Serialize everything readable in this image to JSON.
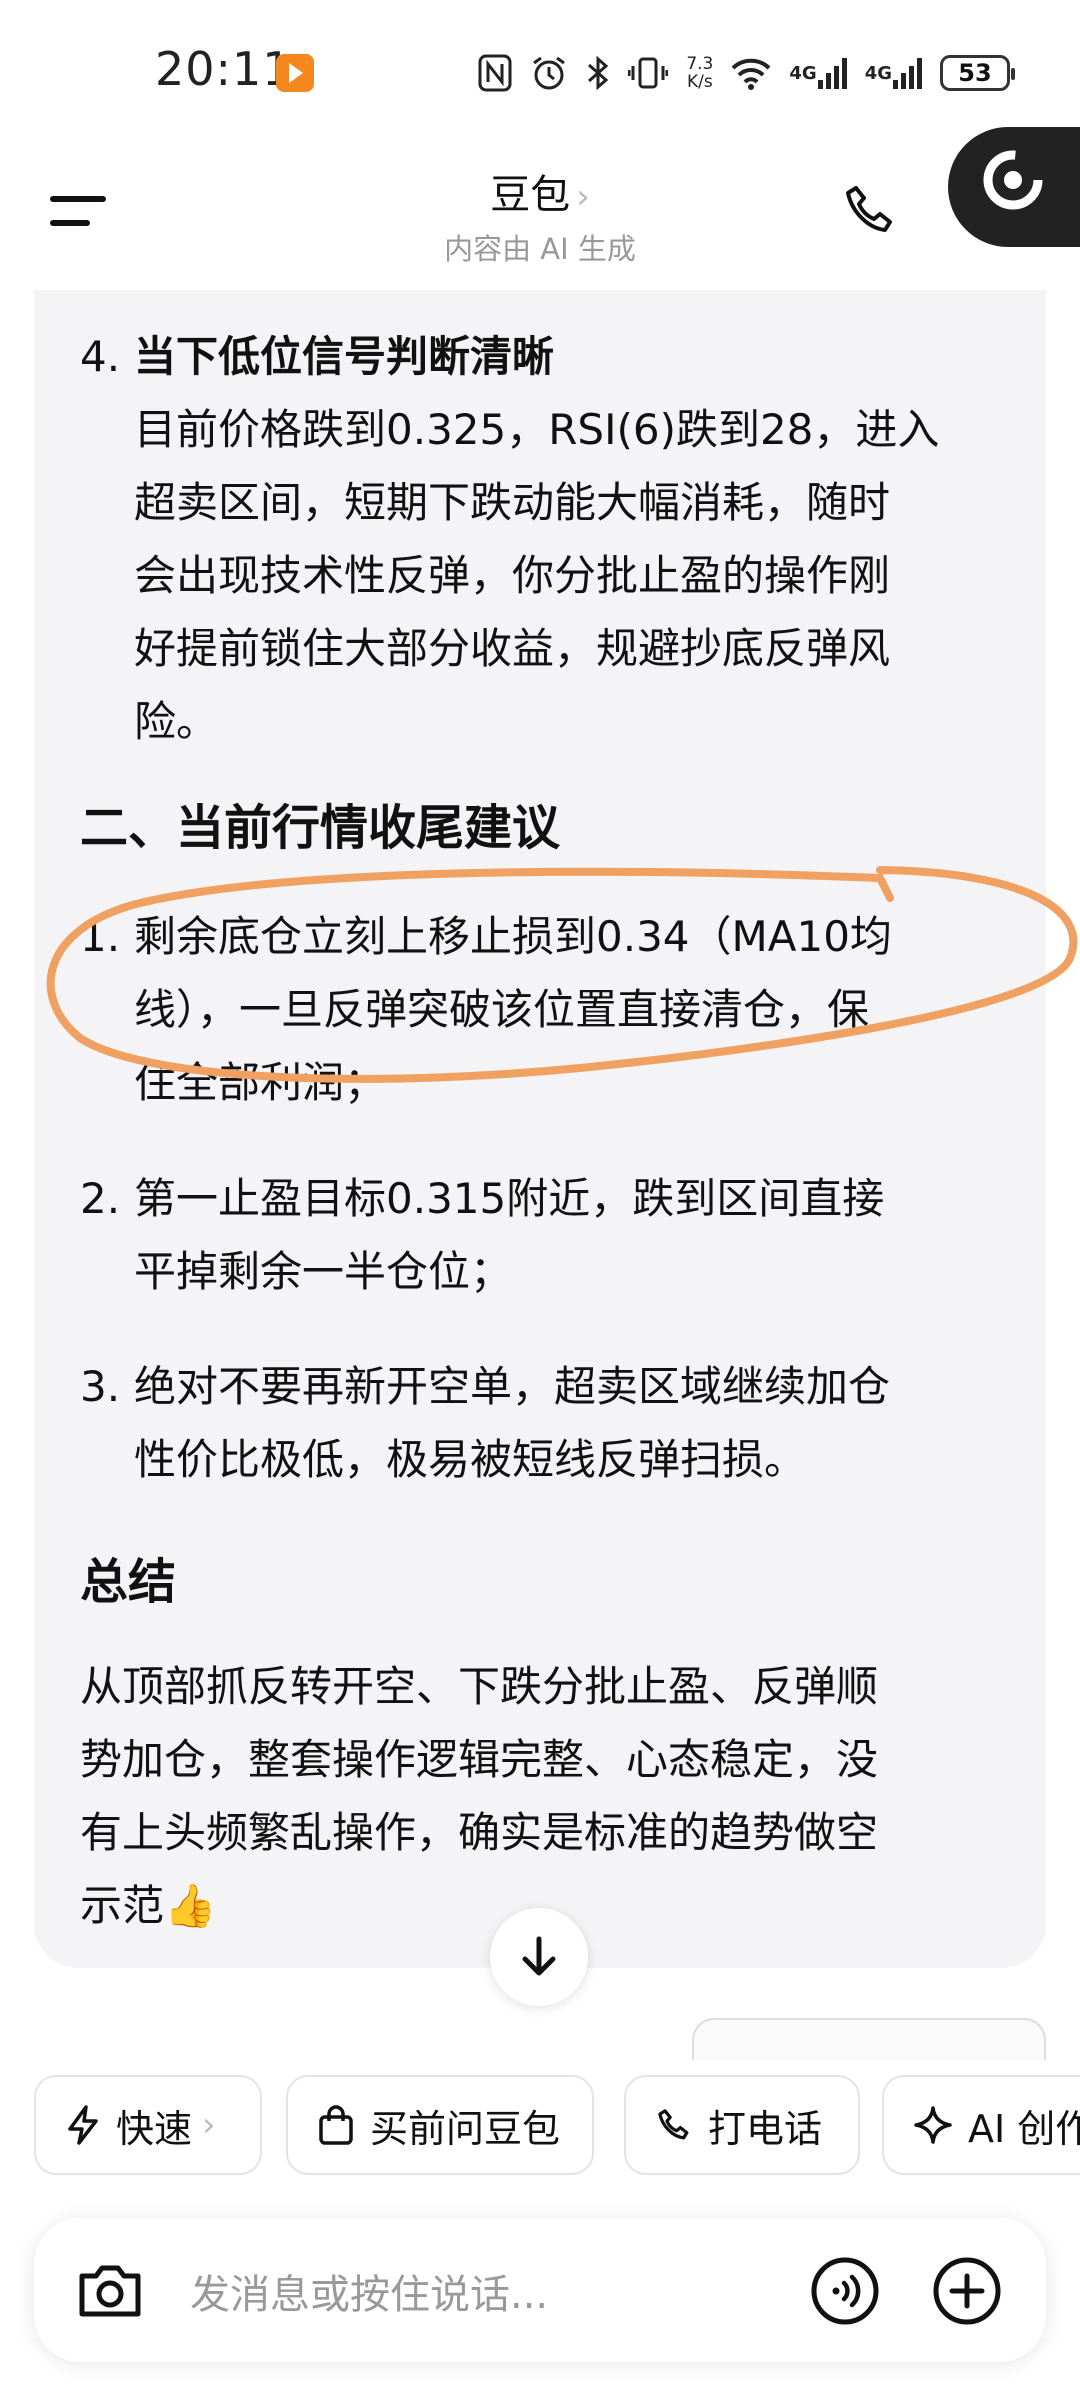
{
  "status_bar": {
    "time": "20:11",
    "net_speed_value": "7.3",
    "net_speed_unit": "K/s",
    "signal_1": "4G",
    "signal_2": "4G",
    "battery": "53"
  },
  "header": {
    "title": "豆包",
    "title_chevron": "›",
    "subtitle": "内容由 AI 生成"
  },
  "content": {
    "item4": {
      "number": "4.",
      "title": "当下低位信号判断清晰",
      "lines": [
        "目前价格跌到0.325，RSI(6)跌到28，进入",
        "超卖区间，短期下跌动能大幅消耗，随时",
        "会出现技术性反弹，你分批止盈的操作刚",
        "好提前锁住大部分收益，规避抄底反弹风",
        "险。"
      ]
    },
    "section2_heading": "二、当前行情收尾建议",
    "advice": [
      {
        "number": "1.",
        "lines": [
          "剩余底仓立刻上移止损到0.34（MA10均",
          "线），一旦反弹突破该位置直接清仓，保",
          "住全部利润；"
        ]
      },
      {
        "number": "2.",
        "lines": [
          "第一止盈目标0.315附近，跌到区间直接",
          "平掉剩余一半仓位；"
        ]
      },
      {
        "number": "3.",
        "lines": [
          "绝对不要再新开空单，超卖区域继续加仓",
          "性价比极低，极易被短线反弹扫损。"
        ]
      }
    ],
    "summary_heading": "总结",
    "summary_lines": [
      "从顶部抓反转开空、下跌分批止盈、反弹顺",
      "势加仓，整套操作逻辑完整、心态稳定，没",
      "有上头频繁乱操作，确实是标准的趋势做空",
      "示范👍"
    ]
  },
  "chips": [
    {
      "label": "快速",
      "chevron": "›",
      "icon": "lightning-icon"
    },
    {
      "label": "买前问豆包",
      "icon": "shopping-bag-icon"
    },
    {
      "label": "打电话",
      "icon": "phone-icon"
    },
    {
      "label": "AI 创作",
      "icon": "sparkle-icon"
    }
  ],
  "input": {
    "placeholder": "发消息或按住说话..."
  },
  "colors": {
    "annotation_orange": "#f0a060",
    "card_bg": "#f4f4f6"
  }
}
